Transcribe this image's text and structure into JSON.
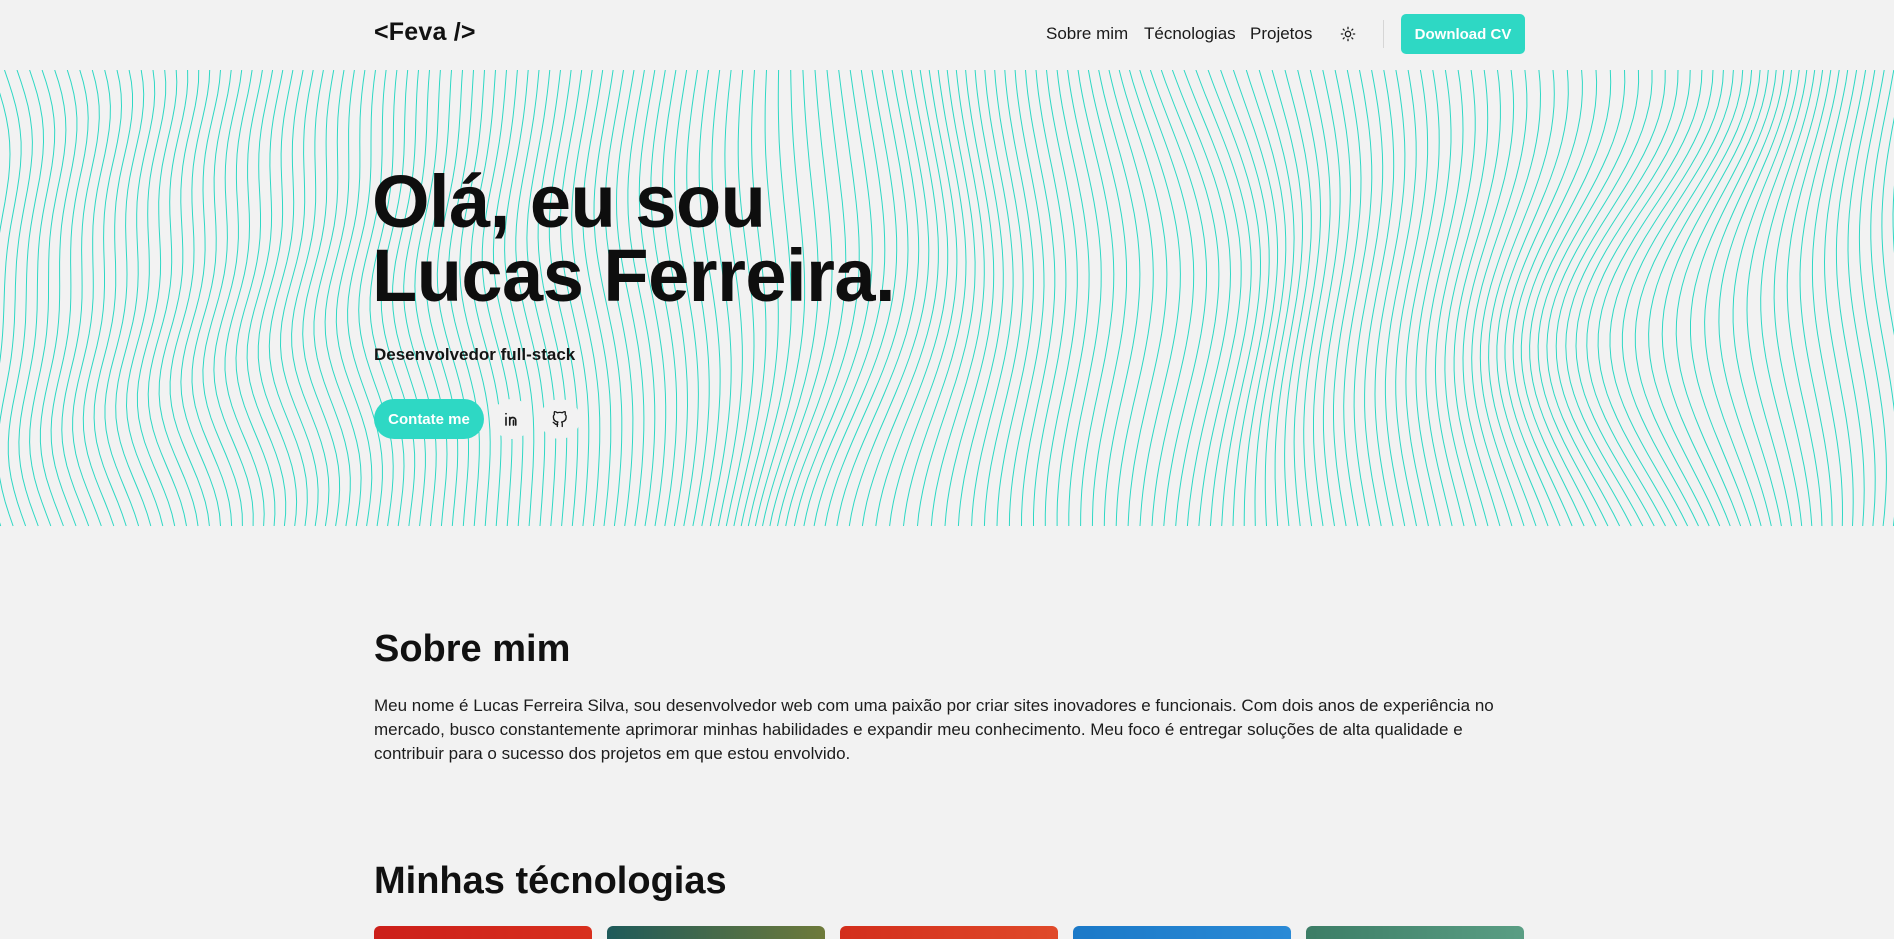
{
  "header": {
    "logo": "<Feva />",
    "nav": [
      {
        "label": "Sobre mim"
      },
      {
        "label": "Técnologias"
      },
      {
        "label": "Projetos"
      }
    ],
    "theme_icon": "sun-icon",
    "download_label": "Download CV"
  },
  "hero": {
    "title_line1": "Olá, eu sou",
    "title_line2": "Lucas Ferreira.",
    "subtitle": "Desenvolvedor full-stack",
    "contact_label": "Contate me",
    "social": [
      {
        "icon": "linkedin-icon"
      },
      {
        "icon": "github-icon"
      }
    ],
    "wave_color": "#2ed8c4"
  },
  "about": {
    "title": "Sobre mim",
    "text": "Meu nome é Lucas Ferreira Silva, sou desenvolvedor web com uma paixão por criar sites inovadores e funcionais. Com dois anos de experiência no mercado, busco constantemente aprimorar minhas habilidades e expandir meu conhecimento. Meu foco é entregar soluções de alta qualidade e contribuir para o sucesso dos projetos em que estou envolvido."
  },
  "technologies": {
    "title": "Minhas técnologias",
    "card_colors": [
      [
        "#cc1f1a",
        "#d8301e"
      ],
      [
        "#1e5a5a",
        "#6e7a3a"
      ],
      [
        "#d32e1c",
        "#e04a2a"
      ],
      [
        "#1b79c8",
        "#2a8ad6"
      ],
      [
        "#3c7d66",
        "#5a9e84"
      ]
    ]
  },
  "colors": {
    "accent": "#2ed8c4",
    "background": "#f2f2f2",
    "text": "#111111"
  }
}
